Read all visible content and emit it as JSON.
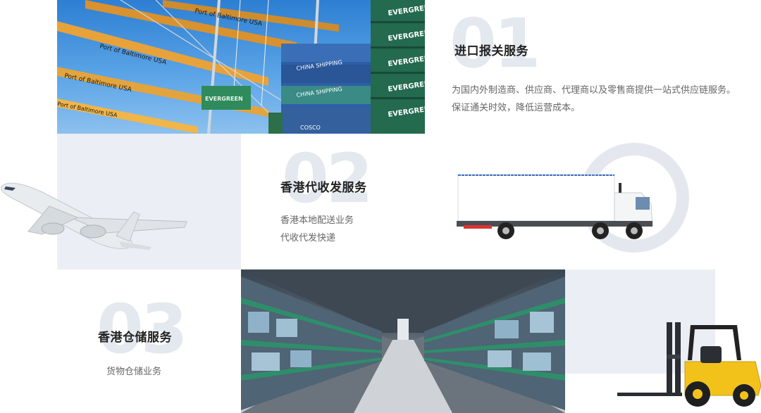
{
  "services": [
    {
      "number": "01",
      "title": "进口报关服务",
      "desc": [
        "为国内外制造商、供应商、代理商以及零售商提供一站式供应链服务。",
        "保证通关时效，降低运营成本。"
      ]
    },
    {
      "number": "02",
      "title": "香港代收发服务",
      "desc": [
        "香港本地配送业务",
        "代收代发快递"
      ]
    },
    {
      "number": "03",
      "title": "香港仓储服务",
      "desc": [
        "货物仓储业务"
      ]
    }
  ],
  "photo_port": {
    "crane_signs": [
      "Port of Baltimore USA",
      "Port of Baltimore USA",
      "Port of Baltimore USA",
      "Port of Baltimore USA"
    ],
    "containers": [
      "EVERGREEN",
      "EVERGREEN",
      "EVERGREEN",
      "EVERGREEN",
      "EVERGREEN",
      "CHINA SHIPPING",
      "CHINA SHIPPING",
      "COSCO",
      "EVERGREEN"
    ]
  },
  "colors": {
    "panel_gray": "#ebeef4",
    "number_watermark": "#e4e8ef",
    "title": "#222222",
    "desc": "#666666"
  }
}
